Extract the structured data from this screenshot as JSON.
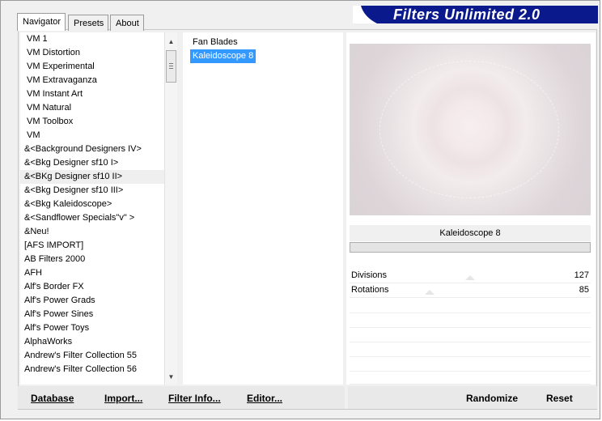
{
  "tabs": [
    {
      "label": "Navigator"
    },
    {
      "label": "Presets"
    },
    {
      "label": "About"
    }
  ],
  "banner": {
    "title": "Filters Unlimited 2.0"
  },
  "categories": [
    {
      "label": "VM 1"
    },
    {
      "label": "VM Distortion"
    },
    {
      "label": "VM Experimental"
    },
    {
      "label": "VM Extravaganza"
    },
    {
      "label": "VM Instant Art"
    },
    {
      "label": "VM Natural"
    },
    {
      "label": "VM Toolbox"
    },
    {
      "label": "VM"
    },
    {
      "label": "&<Background Designers IV>"
    },
    {
      "label": "&<Bkg Designer sf10 I>"
    },
    {
      "label": "&<BKg Designer sf10 II>"
    },
    {
      "label": "&<Bkg Designer sf10 III>"
    },
    {
      "label": "&<Bkg Kaleidoscope>"
    },
    {
      "label": "&<Sandflower Specials\"v\" >"
    },
    {
      "label": "&Neu!"
    },
    {
      "label": "[AFS IMPORT]"
    },
    {
      "label": "AB Filters 2000"
    },
    {
      "label": "AFH"
    },
    {
      "label": "Alf's Border FX"
    },
    {
      "label": "Alf's Power Grads"
    },
    {
      "label": "Alf's Power Sines"
    },
    {
      "label": "Alf's Power Toys"
    },
    {
      "label": "AlphaWorks"
    },
    {
      "label": "Andrew's Filter Collection 55"
    },
    {
      "label": "Andrew's Filter Collection 56"
    }
  ],
  "selected_category_index": 10,
  "filters": [
    {
      "label": "Fan Blades"
    },
    {
      "label": "Kaleidoscope 8"
    }
  ],
  "selected_filter_index": 1,
  "preview": {
    "filter_name": "Kaleidoscope 8"
  },
  "params": [
    {
      "name": "Divisions",
      "value": "127",
      "fraction": 0.5
    },
    {
      "name": "Rotations",
      "value": "85",
      "fraction": 0.333
    }
  ],
  "buttons": {
    "database": "Database",
    "import": "Import...",
    "filter_info": "Filter Info...",
    "editor": "Editor...",
    "randomize": "Randomize",
    "reset": "Reset"
  },
  "colors": {
    "banner_bg": "#0a1a8c",
    "selection": "#3399ff"
  }
}
